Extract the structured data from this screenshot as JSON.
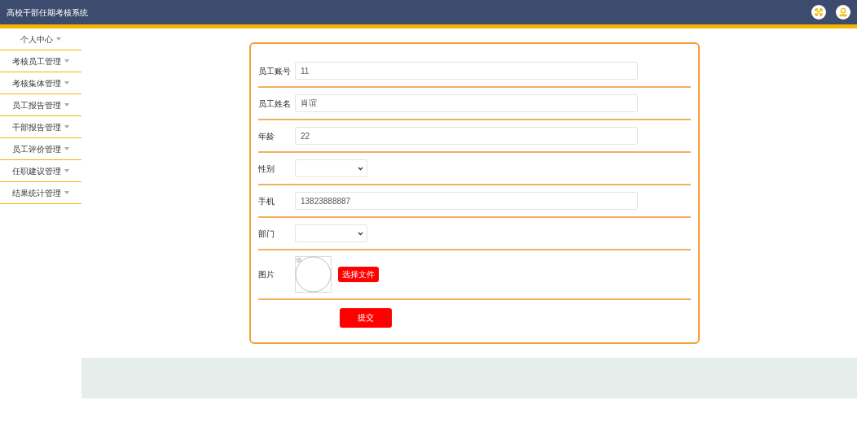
{
  "header": {
    "title": "高校干部任期考核系统"
  },
  "sidebar": {
    "items": [
      {
        "label": "个人中心"
      },
      {
        "label": "考核员工管理"
      },
      {
        "label": "考核集体管理"
      },
      {
        "label": "员工报告管理"
      },
      {
        "label": "干部报告管理"
      },
      {
        "label": "员工评价管理"
      },
      {
        "label": "任职建议管理"
      },
      {
        "label": "结果统计管理"
      }
    ]
  },
  "form": {
    "fields": [
      {
        "kind": "text",
        "label": "员工账号",
        "value": "11"
      },
      {
        "kind": "text",
        "label": "员工姓名",
        "value": "肖谊"
      },
      {
        "kind": "text",
        "label": "年龄",
        "value": "22"
      },
      {
        "kind": "select",
        "label": "性别"
      },
      {
        "kind": "text",
        "label": "手机",
        "value": "13823888887"
      },
      {
        "kind": "select",
        "label": "部门"
      },
      {
        "kind": "image",
        "label": "图片",
        "button": "选择文件"
      }
    ],
    "submit": "提交"
  }
}
